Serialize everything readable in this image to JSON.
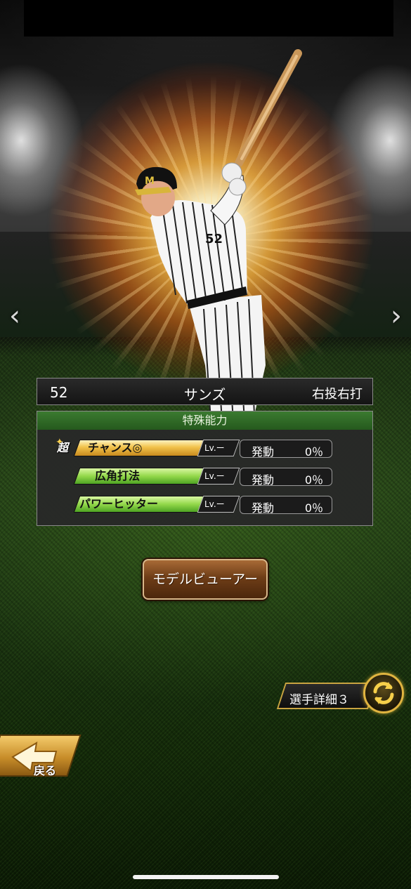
{
  "player": {
    "number": "52",
    "name": "サンズ",
    "throw_bat": "右投右打",
    "jersey_number": "52"
  },
  "abilities": {
    "header": "特殊能力",
    "items": [
      {
        "prefix": "超",
        "name": "チャンス◎",
        "level": "Lv.ー",
        "activation_label": "発動",
        "activation_value": "0％",
        "tier": "gold"
      },
      {
        "prefix": "",
        "name": "広角打法",
        "level": "Lv.ー",
        "activation_label": "発動",
        "activation_value": "0％",
        "tier": "green"
      },
      {
        "prefix": "",
        "name": "パワーヒッター",
        "level": "Lv.ー",
        "activation_label": "発動",
        "activation_value": "0％",
        "tier": "green"
      }
    ]
  },
  "buttons": {
    "model_viewer": "モデルビューアー",
    "player_detail": "選手詳細３",
    "back": "戻る"
  },
  "nav": {
    "prev_icon": "chevron-left-icon",
    "next_icon": "chevron-right-icon"
  },
  "colors": {
    "gold_badge": "#f1c24a",
    "green_badge": "#93d84a",
    "header_green": "#2f6a25",
    "button_brown": "#6e3d17",
    "accent_gold": "#e0b440"
  }
}
